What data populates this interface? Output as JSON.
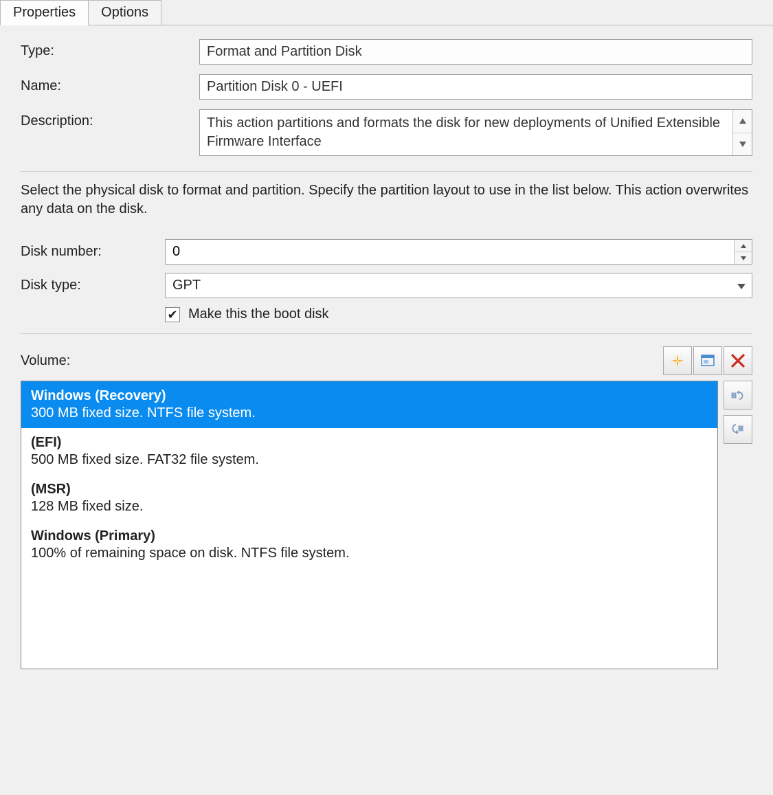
{
  "tabs": {
    "properties": "Properties",
    "options": "Options"
  },
  "form": {
    "type_label": "Type:",
    "type_value": "Format and Partition Disk",
    "name_label": "Name:",
    "name_value": "Partition Disk 0 - UEFI",
    "description_label": "Description:",
    "description_value": "This action partitions and formats the disk for new deployments of Unified Extensible Firmware Interface"
  },
  "instruction": "Select the physical disk to format and partition. Specify the partition layout to use in the list below. This action overwrites any data on the disk.",
  "disk": {
    "number_label": "Disk number:",
    "number_value": "0",
    "type_label": "Disk type:",
    "type_value": "GPT",
    "boot_label": "Make this the boot disk",
    "boot_checked": true
  },
  "volume": {
    "label": "Volume:",
    "items": [
      {
        "title": "Windows (Recovery)",
        "sub": "300 MB fixed size. NTFS file system.",
        "selected": true
      },
      {
        "title": "(EFI)",
        "sub": "500 MB fixed size. FAT32 file system.",
        "selected": false
      },
      {
        "title": "(MSR)",
        "sub": "128 MB fixed size.",
        "selected": false
      },
      {
        "title": "Windows (Primary)",
        "sub": "100% of remaining space on disk. NTFS file system.",
        "selected": false
      }
    ]
  },
  "icons": {
    "check": "✔"
  }
}
